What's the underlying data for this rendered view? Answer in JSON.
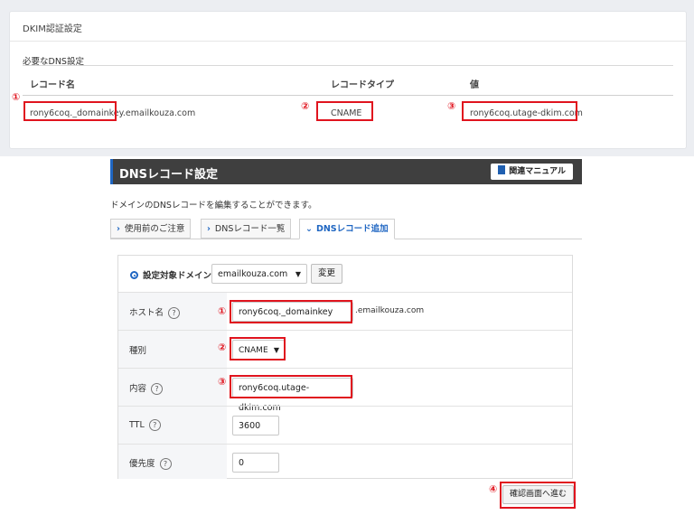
{
  "dkim": {
    "title": "DKIM認証設定",
    "section": "必要なDNS設定",
    "headers": [
      "レコード名",
      "レコードタイプ",
      "値"
    ],
    "row": {
      "name": "rony6coq._domainkey.emailkouza.com",
      "type": "CNAME",
      "value": "rony6coq.utage-dkim.com"
    },
    "markers": [
      "①",
      "②",
      "③"
    ]
  },
  "panel": {
    "title": "DNSレコード設定",
    "manual_label": "関連マニュアル",
    "description": "ドメインのDNSレコードを編集することができます。",
    "tabs": [
      "使用前のご注意",
      "DNSレコード一覧",
      "DNSレコード追加"
    ],
    "tab_prefix": [
      "›",
      "›",
      "⌄"
    ]
  },
  "form": {
    "domain_label": "設定対象ドメイン",
    "domain_value": "emailkouza.com",
    "change_label": "変更",
    "host_label": "ホスト名",
    "host_value": "rony6coq._domainkey",
    "host_suffix": ".emailkouza.com",
    "type_label": "種別",
    "type_value": "CNAME",
    "content_label": "内容",
    "content_value": "rony6coq.utage-dkim.com",
    "ttl_label": "TTL",
    "ttl_value": "3600",
    "priority_label": "優先度",
    "priority_value": "0",
    "help_glyph": "?",
    "confirm_label": "確認画面へ進む",
    "markers": [
      "①",
      "②",
      "③",
      "④"
    ]
  },
  "colors": {
    "highlight": "#e0141e",
    "accent": "#1f66c2",
    "header_bg": "#3f3f3f"
  }
}
